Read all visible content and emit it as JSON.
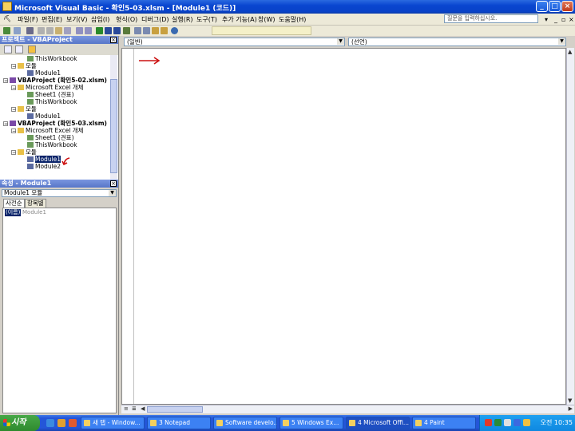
{
  "window": {
    "title": "Microsoft Visual Basic - 확인5-03.xlsm - [Module1 (코드)]"
  },
  "menu": {
    "items": [
      "파일(F)",
      "편집(E)",
      "보기(V)",
      "삽입(I)",
      "형식(O)",
      "디버그(D)",
      "실행(R)",
      "도구(T)",
      "추가 기능(A)",
      "창(W)",
      "도움말(H)"
    ],
    "help_placeholder": "질문을 입력하십시오."
  },
  "project_explorer": {
    "title": "프로젝트 - VBAProject",
    "nodes": [
      {
        "label": "ThisWorkbook",
        "level": 3,
        "type": "sheet"
      },
      {
        "label": "모듈",
        "level": 2,
        "type": "folder"
      },
      {
        "label": "Module1",
        "level": 3,
        "type": "module"
      },
      {
        "label": "VBAProject (확인5-02.xlsm)",
        "level": 1,
        "type": "project"
      },
      {
        "label": "Microsoft Excel 개체",
        "level": 2,
        "type": "folder"
      },
      {
        "label": "Sheet1 (견표)",
        "level": 3,
        "type": "sheet"
      },
      {
        "label": "ThisWorkbook",
        "level": 3,
        "type": "sheet"
      },
      {
        "label": "모듈",
        "level": 2,
        "type": "folder"
      },
      {
        "label": "Module1",
        "level": 3,
        "type": "module"
      },
      {
        "label": "VBAProject (확인5-03.xlsm)",
        "level": 1,
        "type": "project"
      },
      {
        "label": "Microsoft Excel 개체",
        "level": 2,
        "type": "folder"
      },
      {
        "label": "Sheet1 (견표)",
        "level": 3,
        "type": "sheet"
      },
      {
        "label": "ThisWorkbook",
        "level": 3,
        "type": "sheet"
      },
      {
        "label": "모듈",
        "level": 2,
        "type": "folder"
      },
      {
        "label": "Module1",
        "level": 3,
        "type": "module",
        "selected": true
      },
      {
        "label": "Module2",
        "level": 3,
        "type": "module"
      }
    ]
  },
  "properties": {
    "title": "속성 - Module1",
    "object": "Module1 모듈",
    "tabs": [
      "사전순",
      "항목별"
    ],
    "rows": [
      {
        "key": "(이름)",
        "value": "Module1"
      }
    ]
  },
  "code_window": {
    "object_combo": "(일반)",
    "proc_combo": "(선언)"
  },
  "taskbar": {
    "start_label": "시작",
    "tasks": [
      "새 탭 - Window...",
      "3 Notepad",
      "Software develo...",
      "5 Windows Ex...",
      "4 Microsoft Offi...",
      "4 Paint"
    ],
    "active_task": 4,
    "clock": "오전 10:35"
  },
  "colors": {
    "accent": "#0a46d0",
    "annotation": "#cc1111",
    "selection": "#0a246a"
  }
}
